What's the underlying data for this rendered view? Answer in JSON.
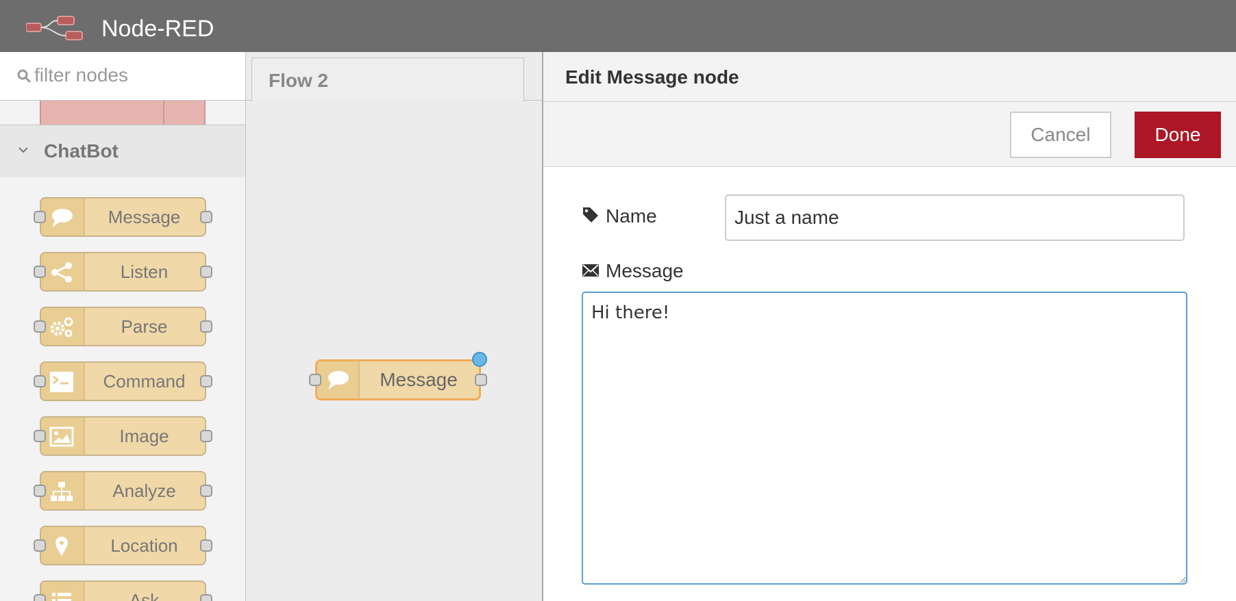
{
  "header": {
    "title": "Node-RED"
  },
  "palette": {
    "filter_placeholder": "filter nodes",
    "category": "ChatBot",
    "nodes": [
      {
        "label": "Message",
        "icon": "speech-bubble-icon"
      },
      {
        "label": "Listen",
        "icon": "share-icon"
      },
      {
        "label": "Parse",
        "icon": "gears-icon"
      },
      {
        "label": "Command",
        "icon": "terminal-icon"
      },
      {
        "label": "Image",
        "icon": "image-icon"
      },
      {
        "label": "Analyze",
        "icon": "hierarchy-icon"
      },
      {
        "label": "Location",
        "icon": "map-pin-icon"
      },
      {
        "label": "Ask",
        "icon": "list-icon"
      }
    ]
  },
  "workspace": {
    "tab": "Flow 2",
    "node": {
      "label": "Message",
      "icon": "speech-bubble-icon"
    }
  },
  "editor": {
    "title": "Edit Message node",
    "cancel_label": "Cancel",
    "done_label": "Done",
    "name_label": "Name",
    "name_value": "Just a name",
    "message_label": "Message",
    "message_value": "Hi there!"
  },
  "colors": {
    "header_bg": "#6d6d6d",
    "node_fill": "#f0d8a8",
    "selected_outline": "#f0ac5a",
    "done_button": "#ad1625",
    "focus_border": "#5b9dd9"
  }
}
